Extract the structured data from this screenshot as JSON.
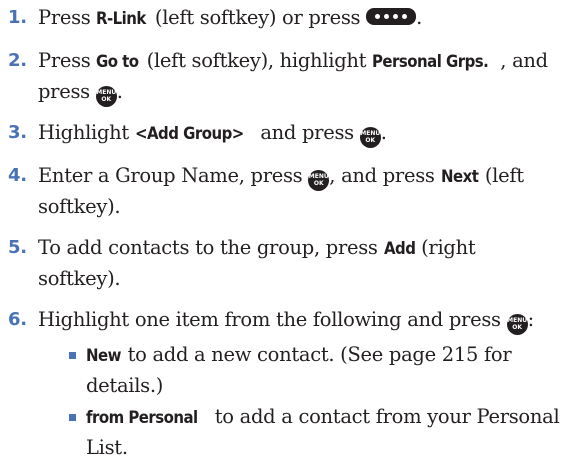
{
  "steps": [
    {
      "num": "1.",
      "a": "Press ",
      "k1": "R-Link",
      "b": " (left softkey) or press ",
      "end": "."
    },
    {
      "num": "2.",
      "a": "Press ",
      "k1": "Go to",
      "b": " (left softkey), highlight ",
      "k2": "Personal Grps.",
      "c": ", and",
      "line2a": "press ",
      "end": "."
    },
    {
      "num": "3.",
      "a": "Highlight ",
      "k1": "<Add Group>",
      "b": " and press ",
      "end": "."
    },
    {
      "num": "4.",
      "a": "Enter a Group Name, press ",
      "b": ", and press ",
      "k1": "Next",
      "c": " (left",
      "line2a": "softkey)."
    },
    {
      "num": "5.",
      "a": "To add contacts to the group, press ",
      "k1": "Add",
      "b": " (right",
      "line2a": "softkey)."
    },
    {
      "num": "6.",
      "a": "Highlight one item from the following and press ",
      "end": ":"
    }
  ],
  "bullets": [
    {
      "k": "New",
      "a": " to add a new contact. (See page 215 for",
      "line2": "details.)"
    },
    {
      "k": "from Personal",
      "a": " to add a contact from your Personal",
      "line2": "List."
    }
  ],
  "icons": {
    "menu_ok_top": "MENU",
    "menu_ok_bottom": "OK",
    "rlink_icon": "r-link-key-icon"
  },
  "colors": {
    "accent": "#4a73b7",
    "text": "#231f20"
  }
}
